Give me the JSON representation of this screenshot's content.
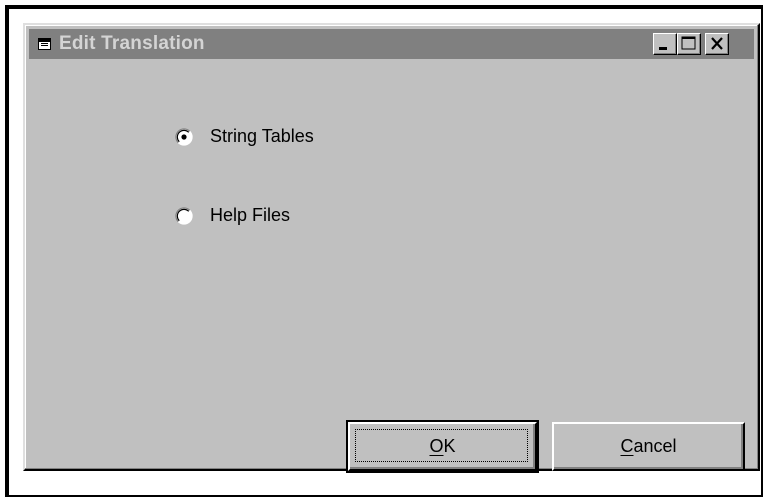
{
  "window": {
    "title": "Edit Translation",
    "icon": "dialog-window-icon",
    "controls": {
      "minimize": "minimize-icon",
      "maximize": "maximize-icon",
      "close": "close-icon"
    }
  },
  "options": {
    "string_tables": {
      "label": "String Tables",
      "selected": true
    },
    "help_files": {
      "label": "Help Files",
      "selected": false
    }
  },
  "buttons": {
    "ok": {
      "label": "OK",
      "accelerator": "O"
    },
    "cancel": {
      "label": "Cancel",
      "accelerator": "C"
    }
  },
  "colors": {
    "face": "#c0c0c0",
    "title_bar_inactive": "#808080",
    "title_text_inactive": "#d4d4d4"
  }
}
